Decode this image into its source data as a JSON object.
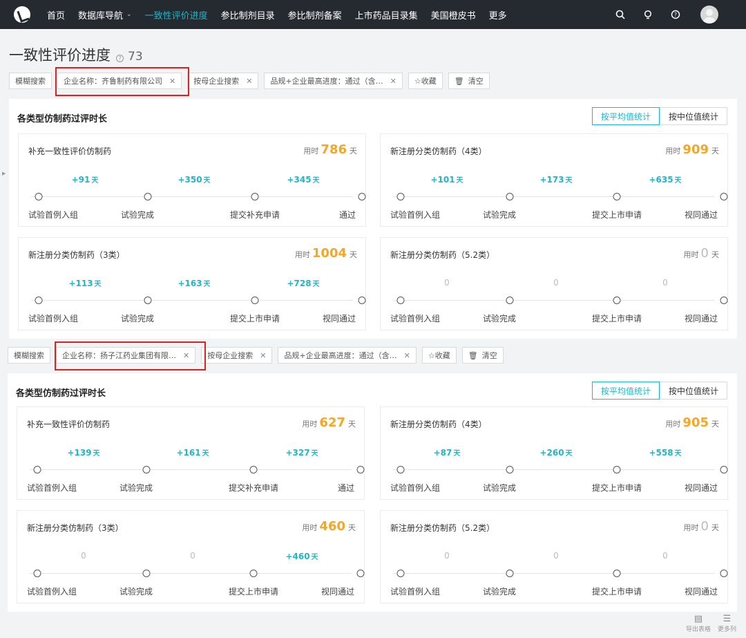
{
  "nav": {
    "items": [
      "首页",
      "数据库导航",
      "一致性评价进度",
      "参比制剂目录",
      "参比制剂备案",
      "上市药品目录集",
      "美国橙皮书",
      "更多"
    ],
    "active_index": 2
  },
  "page": {
    "title": "一致性评价进度",
    "count": "73"
  },
  "sections": [
    {
      "filters": [
        "模糊搜索",
        "企业名称：齐鲁制药有限公司",
        "按母企业搜索",
        "品规+企业最高进度：通过（含…",
        "☆收藏",
        "清空"
      ],
      "panel_title": "各类型仿制药过评时长",
      "toggle": [
        "按平均值统计",
        "按中位值统计"
      ],
      "cards": [
        {
          "name": "补充一致性评价仿制药",
          "prefix": "用时",
          "total": "786",
          "unit": "天",
          "segs": [
            "+91",
            "+350",
            "+345"
          ],
          "stages": [
            "试验首例入组",
            "试验完成",
            "提交补充申请",
            "通过"
          ]
        },
        {
          "name": "新注册分类仿制药（4类）",
          "prefix": "用时",
          "total": "909",
          "unit": "天",
          "segs": [
            "+101",
            "+173",
            "+635"
          ],
          "stages": [
            "试验首例入组",
            "试验完成",
            "提交上市申请",
            "视同通过"
          ]
        },
        {
          "name": "新注册分类仿制药（3类）",
          "prefix": "用时",
          "total": "1004",
          "unit": "天",
          "segs": [
            "+113",
            "+163",
            "+728"
          ],
          "stages": [
            "试验首例入组",
            "试验完成",
            "提交上市申请",
            "视同通过"
          ]
        },
        {
          "name": "新注册分类仿制药（5.2类）",
          "prefix": "用时",
          "total": "0",
          "unit": "天",
          "segs": [
            "0",
            "0",
            "0"
          ],
          "stages": [
            "试验首例入组",
            "试验完成",
            "提交上市申请",
            "视同通过"
          ]
        }
      ]
    },
    {
      "filters": [
        "模糊搜索",
        "企业名称：扬子江药业集团有限…",
        "按母企业搜索",
        "品规+企业最高进度：通过（含…",
        "☆收藏",
        "清空"
      ],
      "panel_title": "各类型仿制药过评时长",
      "toggle": [
        "按平均值统计",
        "按中位值统计"
      ],
      "cards": [
        {
          "name": "补充一致性评价仿制药",
          "prefix": "用时",
          "total": "627",
          "unit": "天",
          "segs": [
            "+139",
            "+161",
            "+327"
          ],
          "stages": [
            "试验首例入组",
            "试验完成",
            "提交补充申请",
            "通过"
          ]
        },
        {
          "name": "新注册分类仿制药（4类）",
          "prefix": "用时",
          "total": "905",
          "unit": "天",
          "segs": [
            "+87",
            "+260",
            "+558"
          ],
          "stages": [
            "试验首例入组",
            "试验完成",
            "提交上市申请",
            "视同通过"
          ]
        },
        {
          "name": "新注册分类仿制药（3类）",
          "prefix": "用时",
          "total": "460",
          "unit": "天",
          "segs": [
            "0",
            "0",
            "+460"
          ],
          "stages": [
            "试验首例入组",
            "试验完成",
            "提交上市申请",
            "视同通过"
          ]
        },
        {
          "name": "新注册分类仿制药（5.2类）",
          "prefix": "用时",
          "total": "0",
          "unit": "天",
          "segs": [
            "0",
            "0",
            "0"
          ],
          "stages": [
            "试验首例入组",
            "试验完成",
            "提交上市申请",
            "视同通过"
          ]
        }
      ]
    }
  ],
  "footer": {
    "export": "导出表格",
    "more_cols": "更多列"
  },
  "icons": [
    "search-icon",
    "lightbulb-icon",
    "help-icon",
    "avatar",
    "export-icon",
    "columns-icon"
  ],
  "colors": {
    "accent": "#1fb6c8",
    "orange": "#f5a623",
    "nav_bg": "#252a31",
    "highlight": "#e02020"
  }
}
